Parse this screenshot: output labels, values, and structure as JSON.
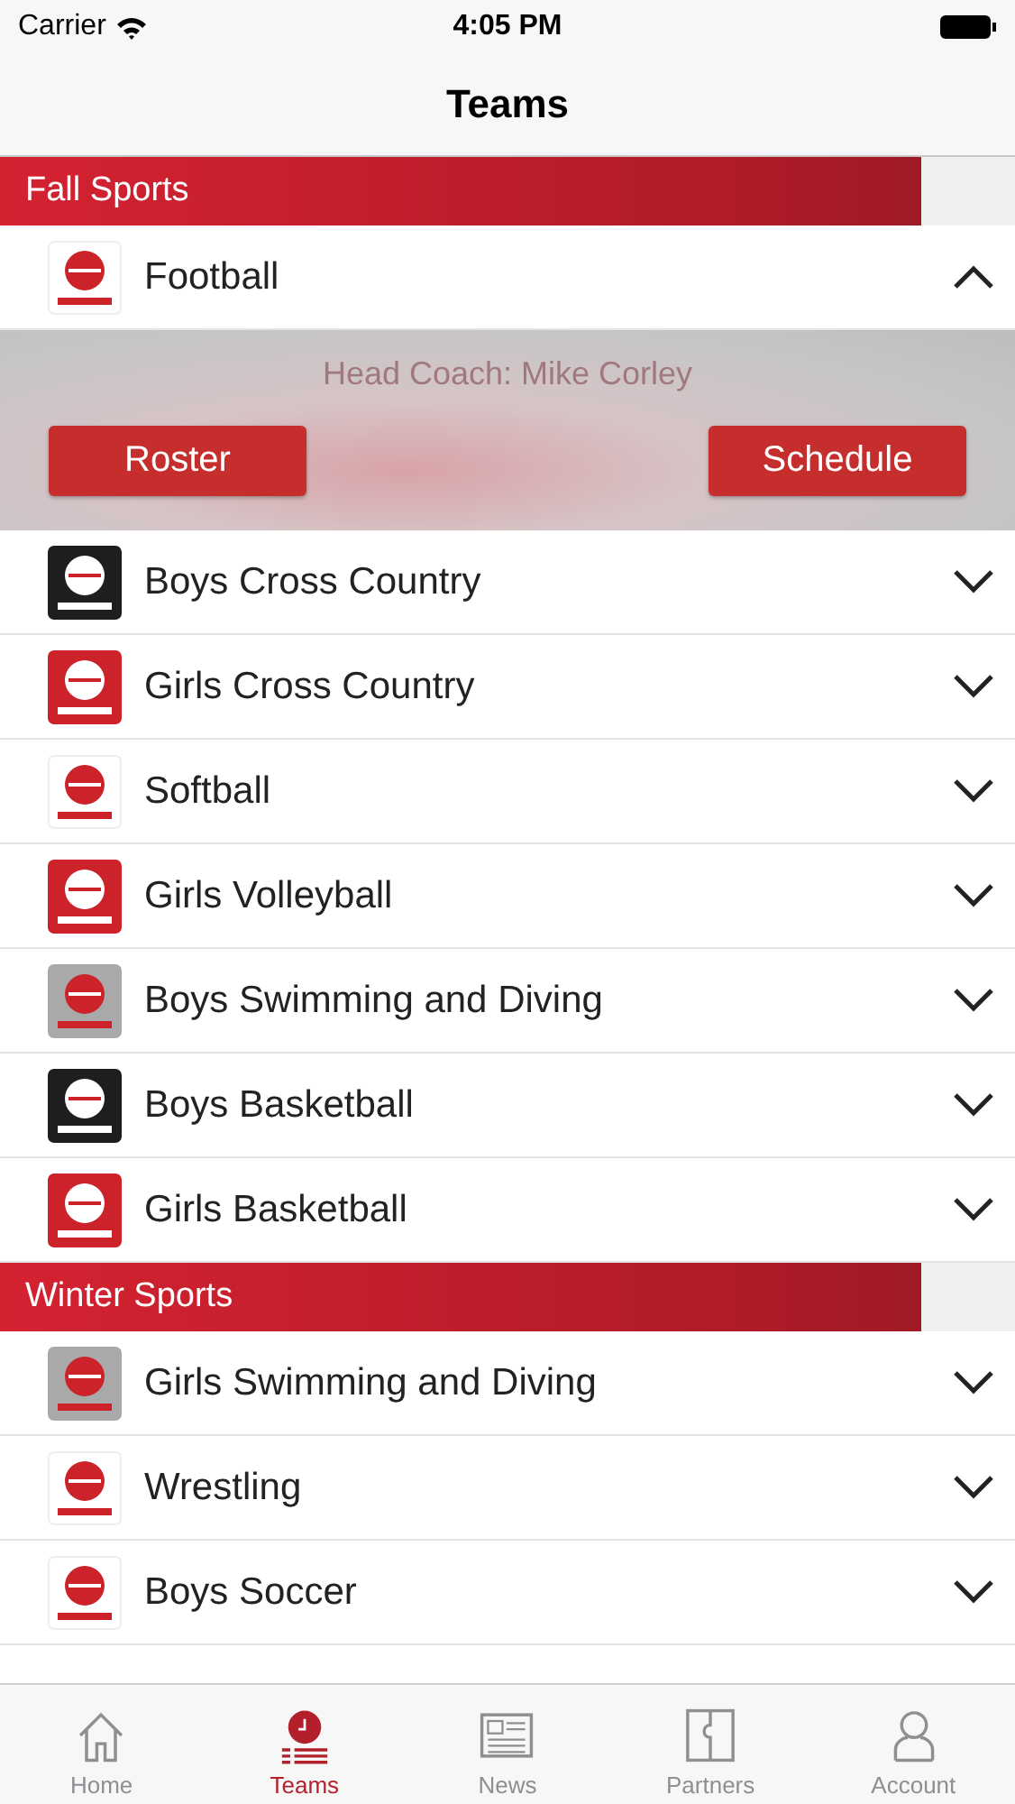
{
  "status_bar": {
    "carrier": "Carrier",
    "time": "4:05 PM"
  },
  "nav": {
    "title": "Teams"
  },
  "sections": [
    {
      "title": "Fall Sports",
      "teams": [
        {
          "name": "Football",
          "expanded": true,
          "coach": "Head Coach: Mike Corley",
          "buttons": [
            "Roster",
            "Schedule"
          ]
        },
        {
          "name": "Boys Cross Country",
          "color": "#1e1e1e",
          "expanded": false
        },
        {
          "name": "Girls Cross Country",
          "color": "#cc2229",
          "expanded": false
        },
        {
          "name": "Softball",
          "expanded": false
        },
        {
          "name": "Girls Volleyball",
          "color": "#cc2229",
          "expanded": false
        },
        {
          "name": "Boys Swimming and Diving",
          "color": "#a9a9a9",
          "expanded": false
        },
        {
          "name": "Boys Basketball",
          "color": "#1e1e1e",
          "expanded": false
        },
        {
          "name": "Girls Basketball",
          "color": "#cc2229",
          "expanded": false
        }
      ]
    },
    {
      "title": "Winter Sports",
      "teams": [
        {
          "name": "Girls Swimming and Diving",
          "color": "#a9a9a9",
          "expanded": false
        },
        {
          "name": "Wrestling",
          "expanded": false
        },
        {
          "name": "Boys Soccer",
          "expanded": false
        }
      ]
    }
  ],
  "tab_bar": [
    {
      "label": "Home",
      "selected": false
    },
    {
      "label": "Teams",
      "selected": true
    },
    {
      "label": "News",
      "selected": false
    },
    {
      "label": "Partners",
      "selected": false
    },
    {
      "label": "Account",
      "selected": false
    }
  ]
}
